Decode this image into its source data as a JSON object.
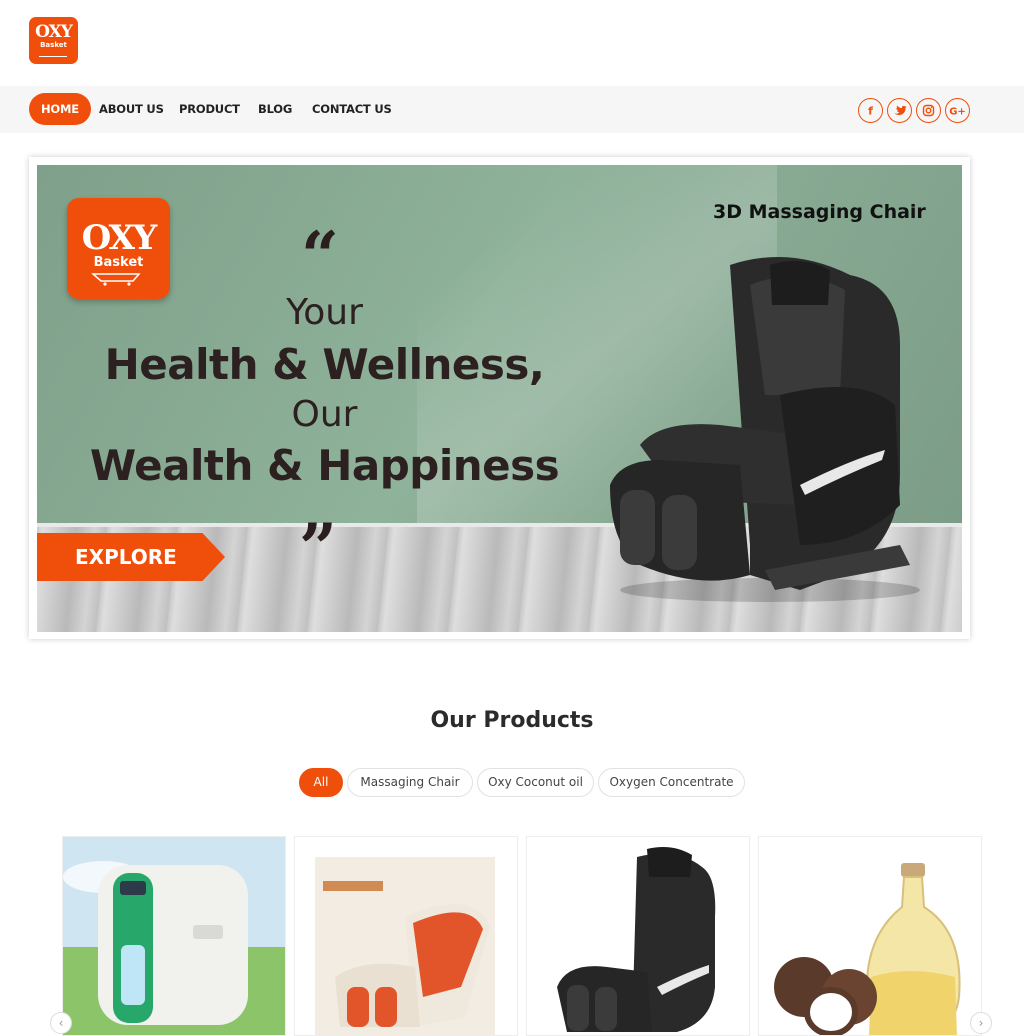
{
  "header": {
    "logo_text": "OXY",
    "logo_subtext": "Basket"
  },
  "nav": {
    "items": [
      "HOME",
      "ABOUT US",
      "PRODUCT",
      "BLOG",
      "CONTACT US"
    ],
    "social": [
      "f",
      "t",
      "ig",
      "G+"
    ]
  },
  "banner": {
    "logo_text": "OXY",
    "logo_subtext": "Basket",
    "quote_open": "“",
    "quote_close": "”",
    "line1": "Your",
    "line2": "Health & Wellness,",
    "line3": "Our",
    "line4": "Wealth & Happiness",
    "explore_label": "EXPLORE",
    "product_title": "3D Massaging Chair"
  },
  "products": {
    "title": "Our Products",
    "filters": [
      "All",
      "Massaging Chair",
      "Oxy Coconut oil",
      "Oxygen Concentrate"
    ],
    "active_filter": "All",
    "cards": [
      {
        "image": "oxygen-concentrator-image"
      },
      {
        "image": "massage-chair-orange-image"
      },
      {
        "image": "massage-chair-black-image"
      },
      {
        "image": "coconut-oil-image"
      }
    ]
  },
  "colors": {
    "accent": "#f04e0b",
    "navbar_bg": "#f6f6f6"
  },
  "icons": {
    "facebook": "facebook-icon",
    "twitter": "twitter-icon",
    "instagram": "instagram-icon",
    "google_plus": "google-plus-icon"
  }
}
